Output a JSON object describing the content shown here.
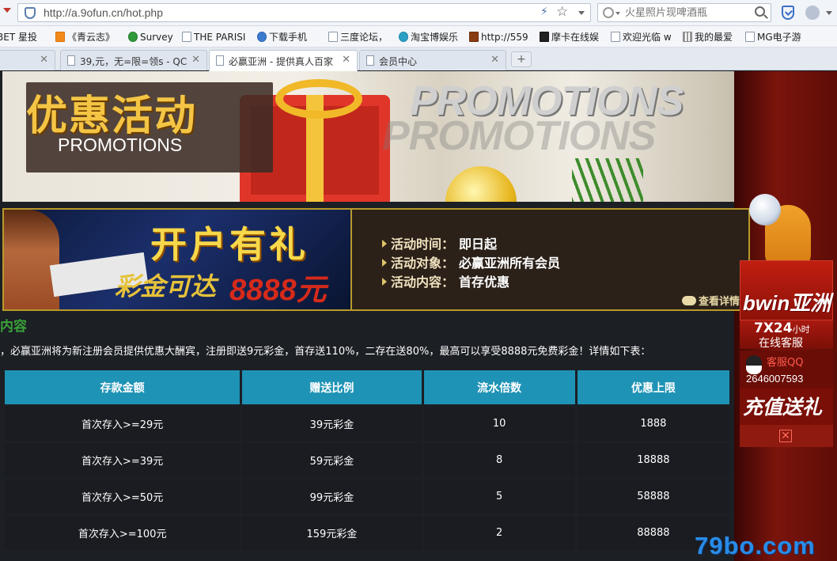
{
  "browser": {
    "url": "http://a.9ofun.cn/hot.php",
    "search_placeholder": "火星照片现啤酒瓶",
    "bookmarks": [
      {
        "label": "BET 星投",
        "icon": "page-icon"
      },
      {
        "label": "《青云志》",
        "icon": "orange-icon"
      },
      {
        "label": "Survey",
        "icon": "green-icon"
      },
      {
        "label": "THE PARISI",
        "icon": "page-icon"
      },
      {
        "label": "下载手机",
        "icon": "blue-icon"
      },
      {
        "label": "三度论坛，",
        "icon": "page-icon"
      },
      {
        "label": "淘宝博娱乐",
        "icon": "teal-icon"
      },
      {
        "label": "http://559",
        "icon": "brown-icon"
      },
      {
        "label": "摩卡在线娱",
        "icon": "black-icon"
      },
      {
        "label": "欢迎光临 w",
        "icon": "page-icon"
      },
      {
        "label": "我的最爱",
        "icon": "grid-icon"
      },
      {
        "label": "MG电子游",
        "icon": "page-icon"
      }
    ],
    "tabs": [
      {
        "label": "39,元，无=限=领s - QC"
      },
      {
        "label": "必赢亚洲 - 提供真人百家"
      },
      {
        "label": "会员中心"
      }
    ],
    "new_tab_label": "+"
  },
  "hero": {
    "title": "优惠活动",
    "subtitle": "PROMOTIONS",
    "promo_text": "PROMOTIONS"
  },
  "banner": {
    "headline": "开户有礼",
    "amount_label": "彩金可达",
    "amount_value": "8888元",
    "rows": [
      {
        "label": "活动时间：",
        "value": "即日起"
      },
      {
        "label": "活动对象：",
        "value": "必赢亚洲所有会员"
      },
      {
        "label": "活动内容：",
        "value": "首存优惠"
      }
    ],
    "view_detail": "查看详情"
  },
  "content": {
    "section_title": "内容",
    "intro": "，必赢亚洲将为新注册会员提供优惠大酬宾，注册即送9元彩金，首存送110%，二存在送80%，最高可以享受8888元免费彩金！详情如下表：",
    "table": {
      "headers": [
        "存款金额",
        "赠送比例",
        "流水倍数",
        "优惠上限"
      ],
      "rows": [
        [
          "首次存入>=29元",
          "39元彩金",
          "10",
          "1888"
        ],
        [
          "首次存入>=39元",
          "59元彩金",
          "8",
          "18888"
        ],
        [
          "首次存入>=50元",
          "99元彩金",
          "5",
          "58888"
        ],
        [
          "首次存入>=100元",
          "159元彩金",
          "2",
          "88888"
        ]
      ]
    }
  },
  "widget": {
    "brand": "bwin亚洲",
    "service_hours": "7X24",
    "service_hours_unit": "小时",
    "service_online": "在线客服",
    "qq_label": "客服QQ",
    "qq_number": "2646007593",
    "recharge": "充值送礼"
  },
  "watermark": "79bo.com"
}
